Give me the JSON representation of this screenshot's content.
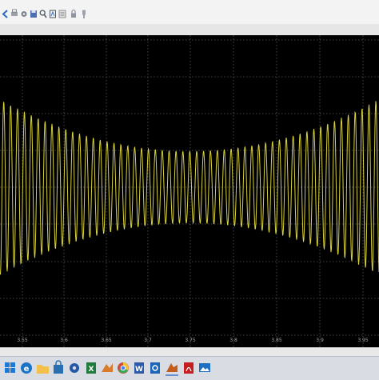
{
  "toolbar": {
    "buttons": [
      {
        "icon": "back-arrow-icon"
      },
      {
        "icon": "print-icon"
      },
      {
        "icon": "settings-icon"
      },
      {
        "icon": "save-icon"
      },
      {
        "icon": "zoom-icon"
      },
      {
        "icon": "autoscale-icon"
      },
      {
        "icon": "params-icon"
      },
      {
        "icon": "lock-icon"
      },
      {
        "icon": "pin-icon"
      }
    ]
  },
  "scope": {
    "background": "#000000",
    "grid_color": "#5a5a5a",
    "trace_color": "#d8d23a",
    "x_tick_labels": [
      "3.55",
      "3.6",
      "3.65",
      "3.7",
      "3.75",
      "3.8",
      "3.85",
      "3.9",
      "3.95"
    ]
  },
  "taskbar": {
    "items": [
      {
        "icon": "start-icon",
        "color": "#1e78d6"
      },
      {
        "icon": "edge-icon",
        "color": "#1a73c6"
      },
      {
        "icon": "folder-icon",
        "color": "#f2c04b"
      },
      {
        "icon": "store-icon",
        "color": "#2b6fb3"
      },
      {
        "icon": "settings-icon",
        "color": "#2458a6"
      },
      {
        "icon": "excel-icon",
        "color": "#1f7a3c"
      },
      {
        "icon": "matlab-icon",
        "color": "#d97b2b"
      },
      {
        "icon": "chrome-icon",
        "color": "#d24b3c"
      },
      {
        "icon": "word-icon",
        "color": "#2a5aa8"
      },
      {
        "icon": "outlook-icon",
        "color": "#1c64b6"
      },
      {
        "icon": "matlab-icon-2",
        "color": "#c45c1d"
      },
      {
        "icon": "acrobat-icon",
        "color": "#c41e1e"
      },
      {
        "icon": "photos-icon",
        "color": "#1e6fc2"
      }
    ]
  }
}
